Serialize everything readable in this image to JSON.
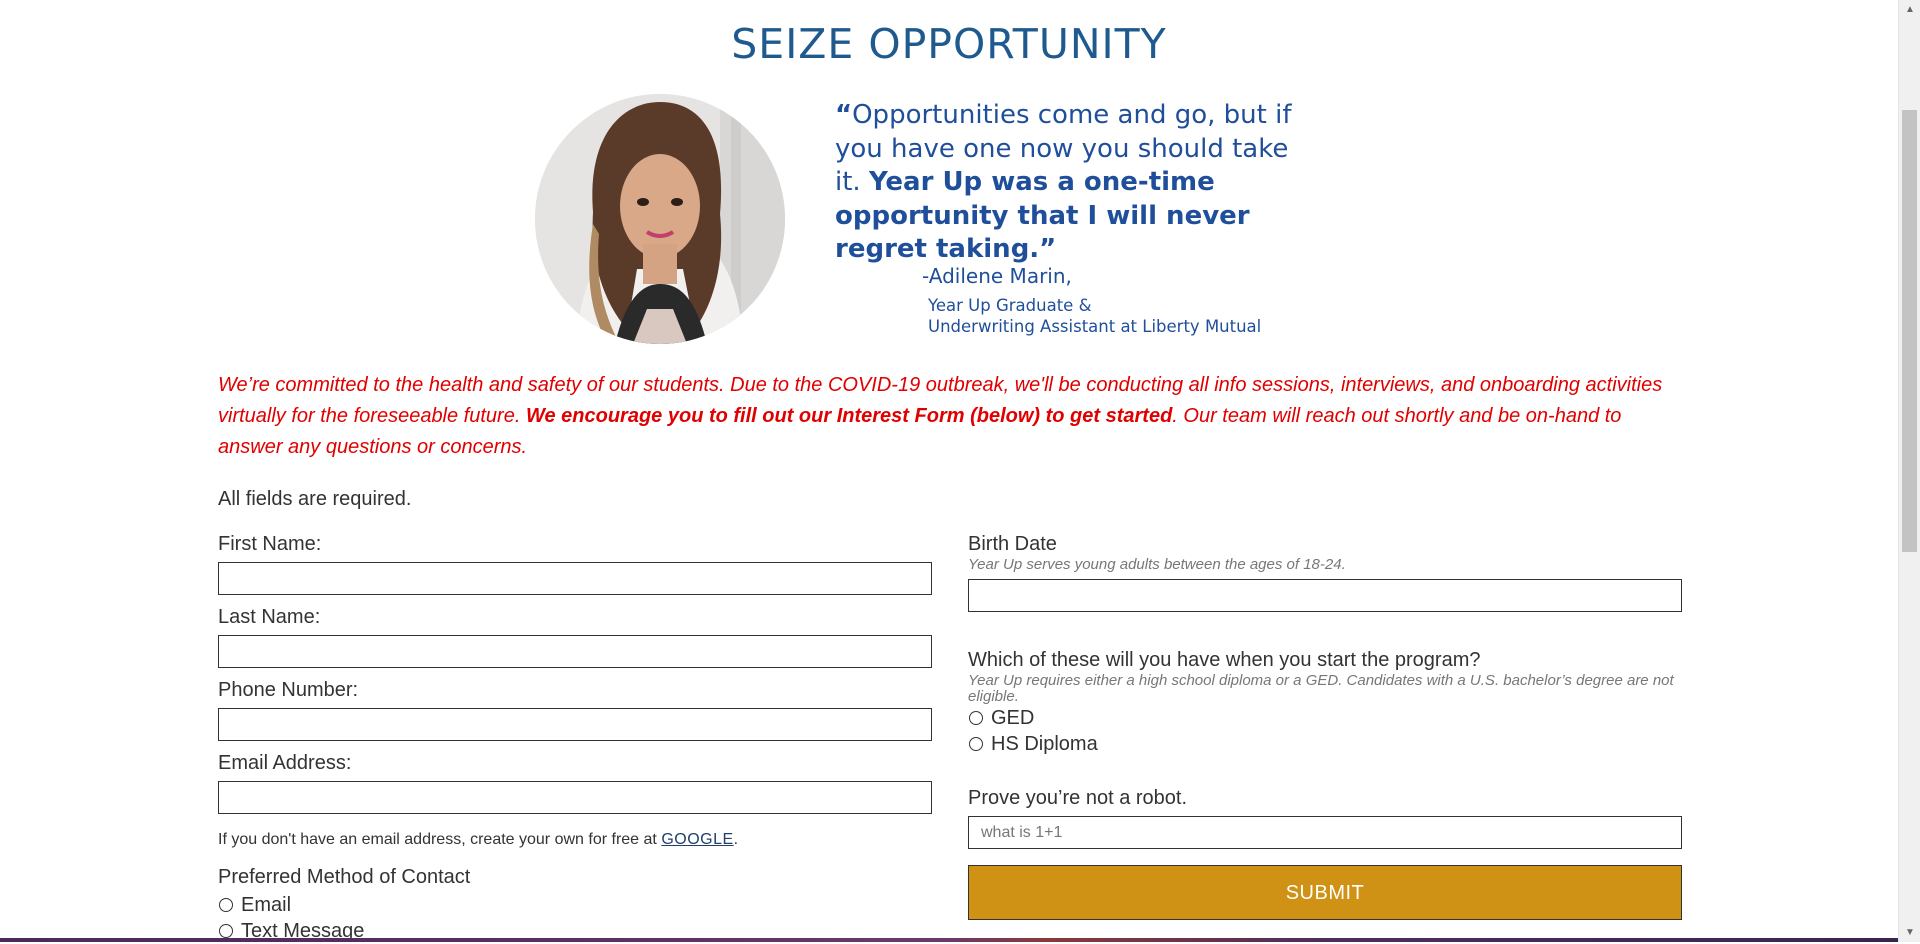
{
  "page": {
    "title": "SEIZE OPPORTUNITY"
  },
  "testimonial": {
    "quote_open": "“",
    "quote_part1": "Opportunities come and go, but if you have one now you should take it.",
    "quote_part2": "Year Up was a one-time opportunity that I will never regret taking.”",
    "attribution_name": "-Adilene Marin,",
    "attribution_line1": "Year Up Graduate &",
    "attribution_line2": "Underwriting Assistant at Liberty Mutual",
    "photo_icon": "person-portrait-photo"
  },
  "notice": {
    "text_start": "We’re committed to the health and safety of our students. Due to the COVID-19 outbreak, we'll be conducting all info sessions, interviews, and onboarding activities virtually for the foreseeable future.",
    "text_bold": "We encourage you to fill out our Interest Form (below) to get started",
    "text_end": ". Our team will reach out shortly and be on-hand to answer any questions or concerns."
  },
  "form": {
    "required_note": "All fields are required.",
    "first_name": {
      "label": "First Name:",
      "value": ""
    },
    "last_name": {
      "label": "Last Name:",
      "value": ""
    },
    "phone": {
      "label": "Phone Number:",
      "value": ""
    },
    "email": {
      "label": "Email Address:",
      "value": ""
    },
    "email_note_prefix": "If you don't have an email address, create your own for free at",
    "email_note_link": "GOOGLE",
    "email_note_suffix": ".",
    "contact_method": {
      "label": "Preferred Method of Contact",
      "options": [
        "Email",
        "Text Message"
      ]
    },
    "birth_date": {
      "label": "Birth Date",
      "hint": "Year Up serves young adults between the ages of 18-24.",
      "value": ""
    },
    "education": {
      "label": "Which of these will you have when you start the program?",
      "hint": "Year Up requires either a high school diploma or a GED. Candidates with a U.S. bachelor’s degree are not eligible.",
      "options": [
        "GED",
        "HS Diploma"
      ]
    },
    "captcha": {
      "label": "Prove you’re not a robot.",
      "placeholder": "what is 1+1",
      "value": ""
    },
    "submit_label": "SUBMIT"
  },
  "colors": {
    "title_blue": "#1f5a8e",
    "quote_blue": "#1f4f9a",
    "notice_red": "#e00000",
    "submit_gold": "#d09215"
  }
}
